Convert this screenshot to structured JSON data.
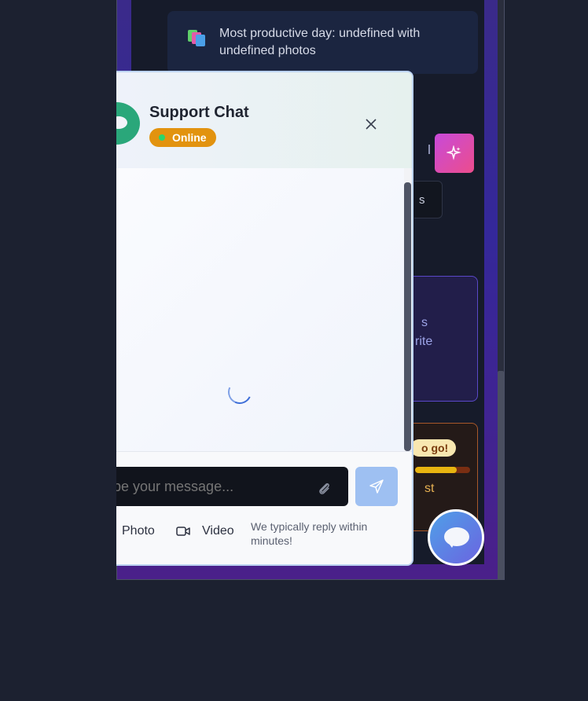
{
  "background_app": {
    "stat_text": "Most productive day: undefined with undefined photos",
    "fragment_button_text": "s",
    "purple_card_line1": "s",
    "purple_card_line2": "rite",
    "orange_card_pill": "o go!",
    "orange_card_text": "st",
    "progress_fraction": 0.75
  },
  "chat": {
    "title": "Support Chat",
    "status": "Online",
    "close_label": "×",
    "input_placeholder": "pe your message...",
    "photo_label": "Photo",
    "video_label": "Video",
    "reply_note": "We typically reply within minutes!"
  },
  "colors": {
    "status_badge": "#e2930f",
    "send_button": "#9ec0f2",
    "launcher_start": "#4fa0e8",
    "launcher_end": "#6b64e0"
  }
}
